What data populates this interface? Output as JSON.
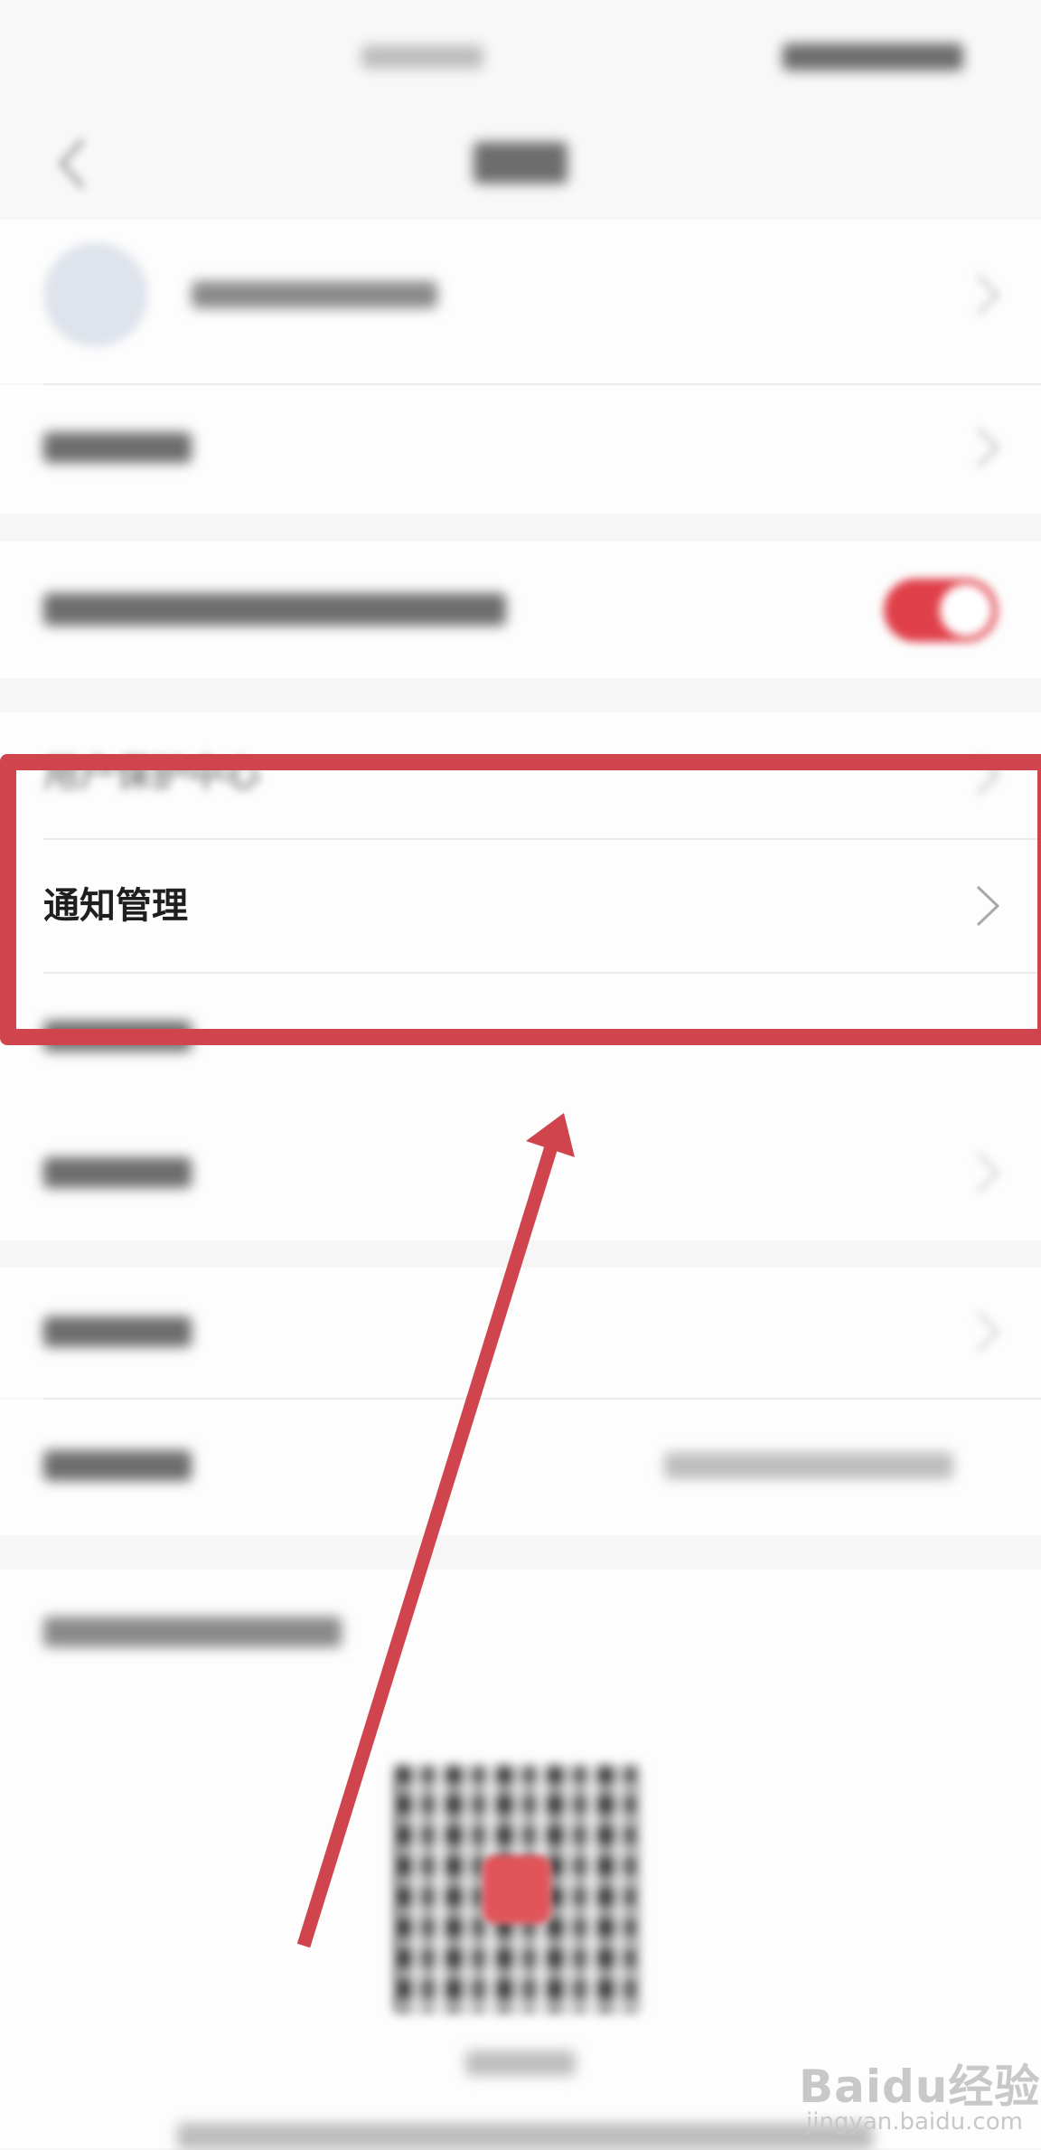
{
  "settings_list": {
    "items": [
      {
        "label": "用户保护中心"
      },
      {
        "label": "通知管理"
      }
    ]
  },
  "watermark": {
    "logo": "Baidu经验",
    "url": "jingyan.baidu.com"
  },
  "colors": {
    "highlight_box": "#d0454d",
    "toggle_on": "#e0404a",
    "background": "#f6f6f6"
  },
  "icons": [
    "back-arrow-icon",
    "chevron-right-icon",
    "avatar-icon",
    "toggle-switch",
    "qr-code",
    "annotation-arrow"
  ]
}
